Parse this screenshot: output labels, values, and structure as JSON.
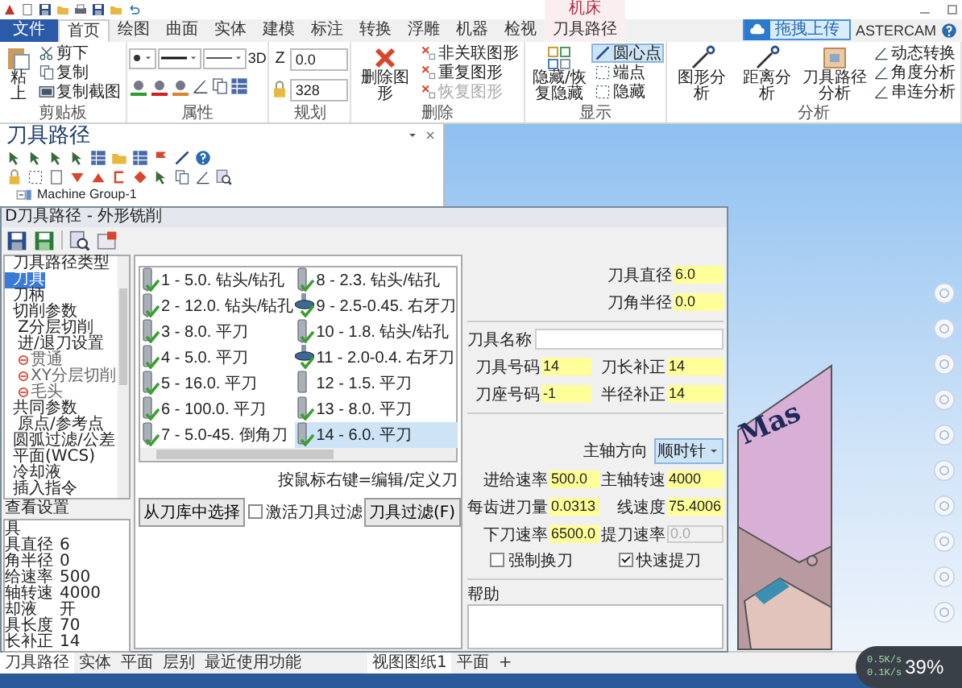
{
  "title_bar": {
    "context_label": "机床"
  },
  "tabs": [
    {
      "label": "文件",
      "kind": "file",
      "selected": false
    },
    {
      "label": "首页",
      "kind": "normal",
      "selected": true
    },
    {
      "label": "绘图",
      "kind": "normal",
      "selected": false
    },
    {
      "label": "曲面",
      "kind": "normal",
      "selected": false
    },
    {
      "label": "实体",
      "kind": "normal",
      "selected": false
    },
    {
      "label": "建模",
      "kind": "normal",
      "selected": false
    },
    {
      "label": "标注",
      "kind": "normal",
      "selected": false
    },
    {
      "label": "转换",
      "kind": "normal",
      "selected": false
    },
    {
      "label": "浮雕",
      "kind": "normal",
      "selected": false
    },
    {
      "label": "机器",
      "kind": "normal",
      "selected": false
    },
    {
      "label": "检视",
      "kind": "normal",
      "selected": false
    },
    {
      "label": "刀具路径",
      "kind": "context",
      "selected": false
    }
  ],
  "upload_button": "拖拽上传",
  "product_name": "ASTERCAM",
  "ribbon": [
    {
      "label": "剪贴板",
      "kind": "items",
      "items": [
        {
          "label": "粘上",
          "kind": "large"
        },
        {
          "label": "剪下",
          "kind": "small"
        },
        {
          "label": "复制",
          "kind": "small"
        },
        {
          "label": "复制截图",
          "kind": "small"
        }
      ]
    },
    {
      "label": "属性",
      "kind": "attributes",
      "mode": "3D"
    },
    {
      "label": "规划",
      "kind": "plane",
      "z_label": "Z",
      "z_value": "0.0",
      "level_value": "328"
    },
    {
      "label": "删除",
      "kind": "items",
      "items": [
        {
          "label": "删除图形",
          "kind": "large",
          "disabled": false
        },
        {
          "label": "非关联图形",
          "kind": "small",
          "disabled": false
        },
        {
          "label": "重复图形",
          "kind": "small",
          "disabled": false
        },
        {
          "label": "恢复图形",
          "kind": "small",
          "disabled": true
        }
      ]
    },
    {
      "label": "显示",
      "kind": "items",
      "items": [
        {
          "label": "隐藏/恢复隐藏",
          "kind": "large",
          "selected": false
        },
        {
          "label": "圆心点",
          "kind": "small",
          "selected": true
        },
        {
          "label": "端点",
          "kind": "small",
          "selected": false
        },
        {
          "label": "隐藏",
          "kind": "small",
          "selected": false
        }
      ]
    },
    {
      "label": "分析",
      "kind": "items",
      "items": [
        {
          "label": "图形分析",
          "kind": "large"
        },
        {
          "label": "距离分析",
          "kind": "large"
        },
        {
          "label": "刀具路径分析",
          "kind": "large"
        },
        {
          "label": "动态转换",
          "kind": "small"
        },
        {
          "label": "角度分析",
          "kind": "small"
        },
        {
          "label": "串连分析",
          "kind": "small"
        }
      ]
    }
  ],
  "toolpath_panel": {
    "title": "刀具路径",
    "tree": [
      {
        "label": "Machine Group-1"
      }
    ]
  },
  "viewport": {
    "model_label": "Mas"
  },
  "dialog": {
    "title": "D刀具路径 - 外形铣削",
    "tree": [
      {
        "label": "刀具路径类型",
        "selected": false
      },
      {
        "label": "刀具",
        "selected": true
      },
      {
        "label": "刀柄",
        "selected": false
      },
      {
        "label": "切削参数",
        "selected": false,
        "children": [
          {
            "label": "Z分层切削",
            "selected": false,
            "disabled": false
          },
          {
            "label": "进/退刀设置",
            "selected": false,
            "disabled": false
          },
          {
            "label": "贯通",
            "selected": false,
            "disabled": true
          },
          {
            "label": "XY分层切削",
            "selected": false,
            "disabled": true
          },
          {
            "label": "毛头",
            "selected": false,
            "disabled": true
          }
        ]
      },
      {
        "label": "共同参数",
        "selected": false,
        "children": [
          {
            "label": "原点/参考点",
            "selected": false,
            "disabled": false
          }
        ]
      },
      {
        "label": "圆弧过滤/公差",
        "selected": false
      },
      {
        "label": "平面(WCS)",
        "selected": false
      },
      {
        "label": "冷却液",
        "selected": false
      },
      {
        "label": "插入指令",
        "selected": false
      }
    ],
    "quick_view": {
      "title": "查看设置",
      "rows": [
        {
          "label": "具"
        },
        {
          "label": "具直径",
          "value": "6"
        },
        {
          "label": "角半径",
          "value": "0"
        },
        {
          "label": "给速率",
          "value": "500"
        },
        {
          "label": "轴转速",
          "value": "4000"
        },
        {
          "label": "却液",
          "value": "开"
        },
        {
          "label": "具长度",
          "value": "70"
        },
        {
          "label": "长补正",
          "value": "14"
        }
      ]
    },
    "tools": [
      {
        "label": "1 - 5.0. 钻头/钻孔",
        "kind": "drill",
        "checked": true,
        "selected": false
      },
      {
        "label": "2 - 12.0. 钻头/钻孔",
        "kind": "drill",
        "checked": true,
        "selected": false
      },
      {
        "label": "3 - 8.0. 平刀",
        "kind": "flat",
        "checked": true,
        "selected": false
      },
      {
        "label": "4 - 5.0. 平刀",
        "kind": "flat",
        "checked": true,
        "selected": false
      },
      {
        "label": "5 - 16.0. 平刀",
        "kind": "flat",
        "checked": true,
        "selected": false
      },
      {
        "label": "6 - 100.0. 平刀",
        "kind": "flat",
        "checked": true,
        "selected": false
      },
      {
        "label": "7 - 5.0-45. 倒角刀",
        "kind": "chamfer",
        "checked": true,
        "selected": false
      },
      {
        "label": "8 - 2.3. 钻头/钻孔",
        "kind": "drill",
        "checked": true,
        "selected": false
      },
      {
        "label": "9 - 2.5-0.45. 右牙刀",
        "kind": "thread",
        "checked": true,
        "selected": false
      },
      {
        "label": "10 - 1.8. 钻头/钻孔",
        "kind": "drill",
        "checked": true,
        "selected": false
      },
      {
        "label": "11 - 2.0-0.4. 右牙刀",
        "kind": "thread",
        "checked": true,
        "selected": false
      },
      {
        "label": "12 - 1.5. 平刀",
        "kind": "flat",
        "checked": false,
        "selected": false
      },
      {
        "label": "13 - 8.0. 平刀",
        "kind": "flat",
        "checked": true,
        "selected": false
      },
      {
        "label": "14 - 6.0. 平刀",
        "kind": "flat",
        "checked": true,
        "selected": true
      }
    ],
    "tool_hint": "按鼠标右键=编辑/定义刀",
    "select_button": "从刀库中选择",
    "filter_option": {
      "label": "激活刀具过滤",
      "checked": false
    },
    "filter_button": "刀具过滤(F)",
    "tool_params": [
      {
        "label": "刀具直径",
        "value": "6.0"
      },
      {
        "label": "刀角半径",
        "value": "0.0"
      }
    ],
    "tool_name_label": "刀具名称",
    "tool_numbers": [
      {
        "label": "刀具号码",
        "value": "14"
      },
      {
        "label": "刀长补正",
        "value": "14"
      },
      {
        "label": "刀座号码",
        "value": "-1"
      },
      {
        "label": "半径补正",
        "value": "14"
      }
    ],
    "spindle_direction": {
      "label": "主轴方向",
      "value": "顺时针"
    },
    "feeds": [
      {
        "label": "进给速率",
        "value": "500.0",
        "disabled": false
      },
      {
        "label": "主轴转速",
        "value": "4000",
        "disabled": false
      },
      {
        "label": "每齿进刀量",
        "value": "0.0313",
        "disabled": false
      },
      {
        "label": "线速度",
        "value": "75.4006",
        "disabled": false
      },
      {
        "label": "下刀速率",
        "value": "6500.0",
        "disabled": false
      },
      {
        "label": "提刀速率",
        "value": "0.0",
        "disabled": true
      }
    ],
    "options": [
      {
        "label": "强制换刀",
        "checked": false
      },
      {
        "label": "快速提刀",
        "checked": true
      }
    ],
    "help_label": "帮助"
  },
  "bottom_tabs": [
    {
      "label": "刀具路径",
      "selected": true
    },
    {
      "label": "实体",
      "selected": false
    },
    {
      "label": "平面",
      "selected": false
    },
    {
      "label": "层别",
      "selected": false
    },
    {
      "label": "最近使用功能",
      "selected": false
    }
  ],
  "view_tabs": [
    {
      "label": "视图图纸1",
      "selected": true
    },
    {
      "label": "平面",
      "selected": false
    }
  ],
  "add_view": "+",
  "net_monitor": {
    "upload": "0.5K/s",
    "download": "0.1K/s",
    "percent": "39%"
  }
}
